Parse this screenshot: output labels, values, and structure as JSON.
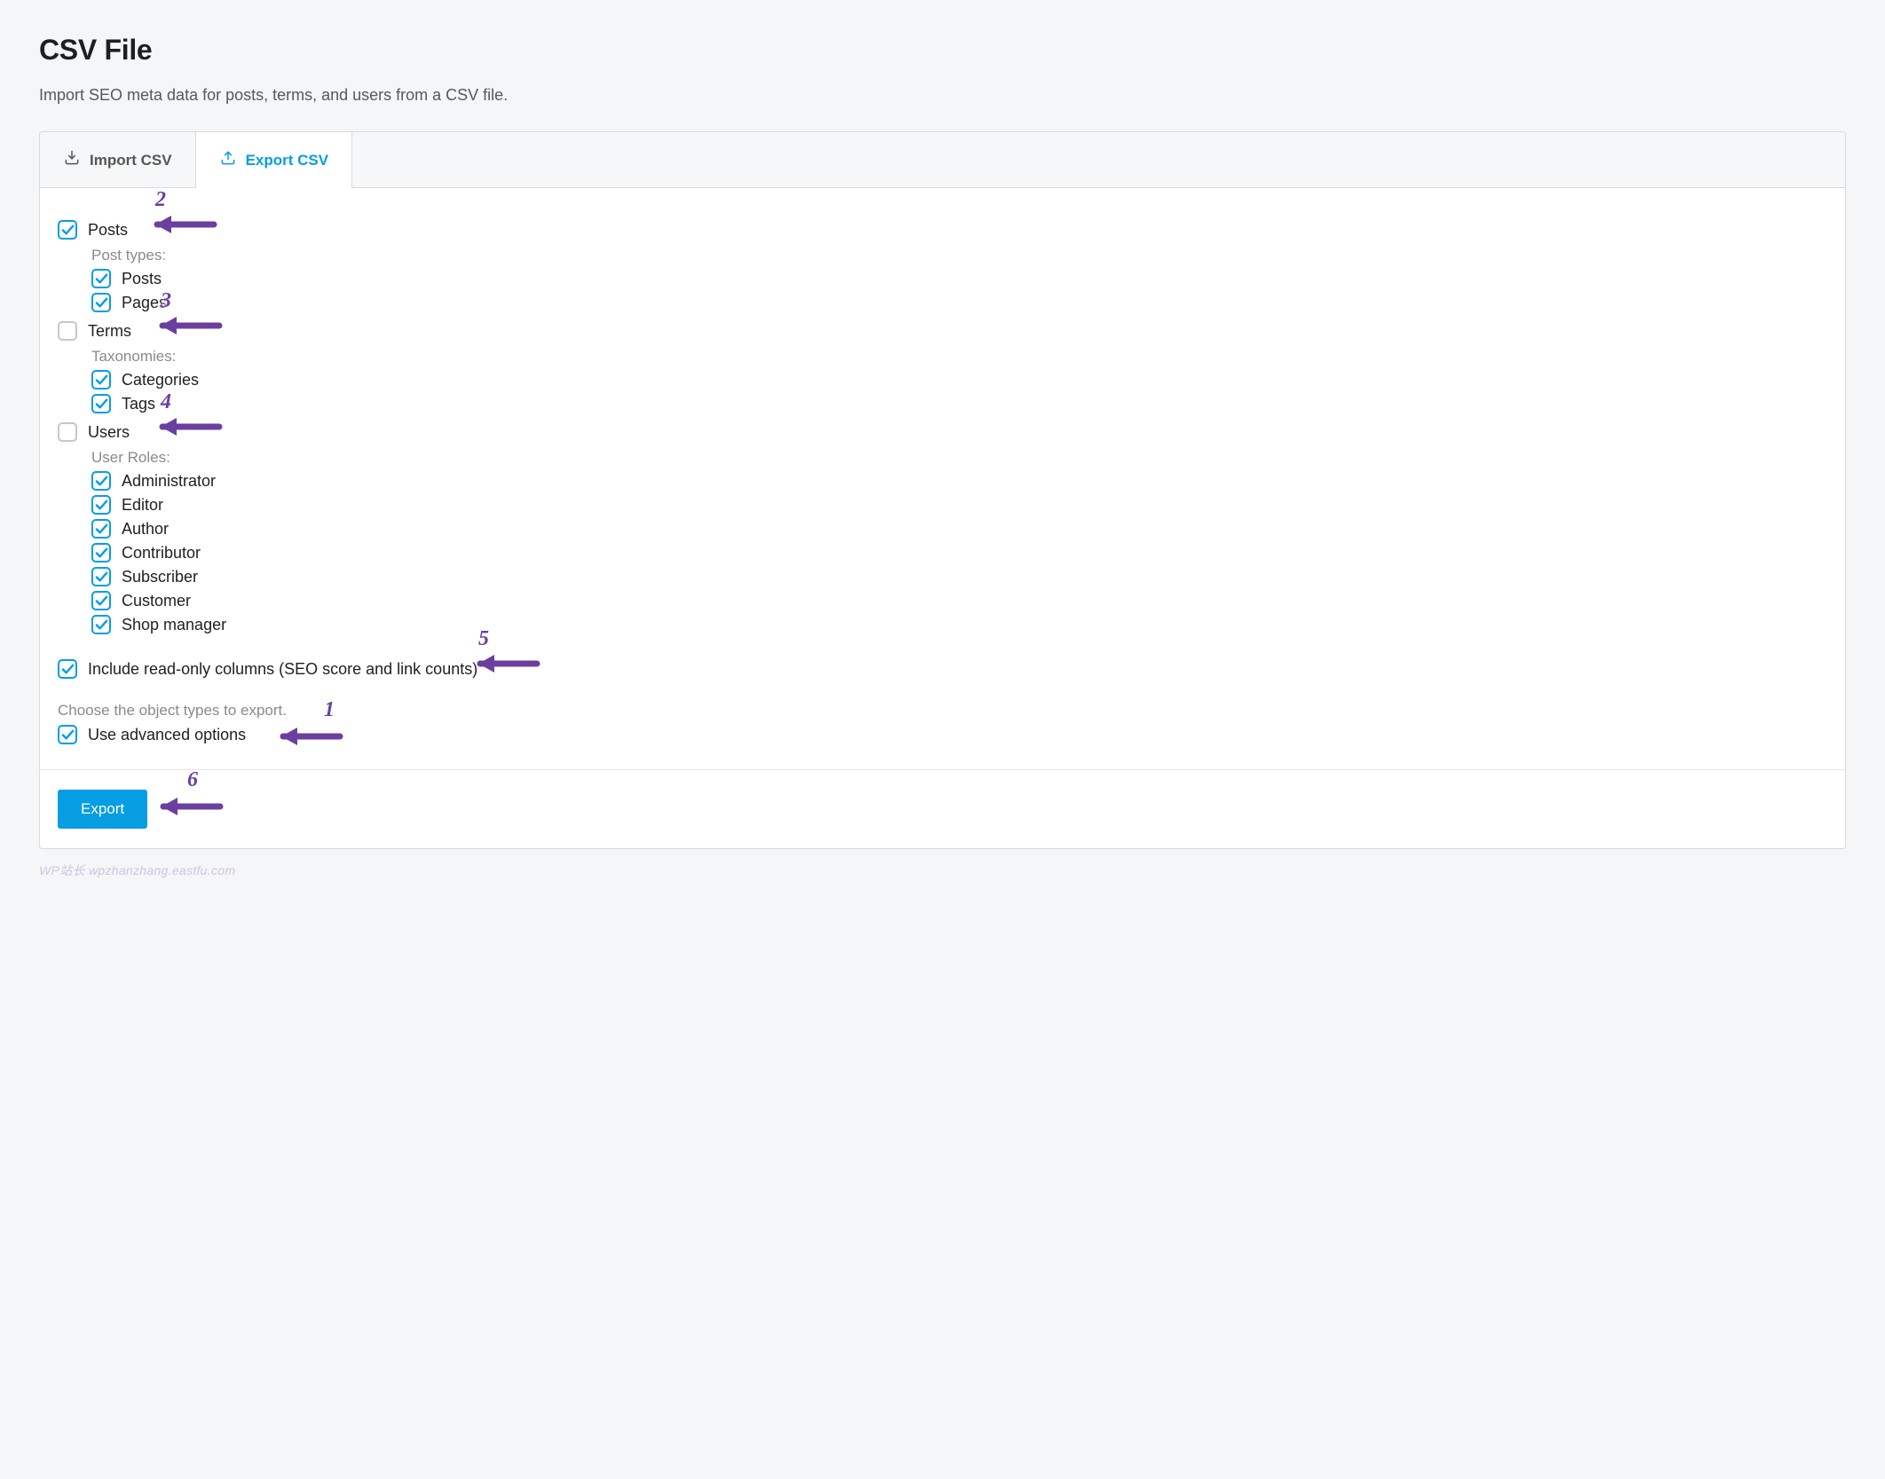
{
  "header": {
    "title": "CSV File",
    "subtitle": "Import SEO meta data for posts, terms, and users from a CSV file."
  },
  "tabs": {
    "import": "Import CSV",
    "export": "Export CSV"
  },
  "sections": {
    "posts": {
      "label": "Posts",
      "sub_label": "Post types:",
      "items": {
        "posts": "Posts",
        "pages": "Pages"
      }
    },
    "terms": {
      "label": "Terms",
      "sub_label": "Taxonomies:",
      "items": {
        "categories": "Categories",
        "tags": "Tags"
      }
    },
    "users": {
      "label": "Users",
      "sub_label": "User Roles:",
      "items": {
        "administrator": "Administrator",
        "editor": "Editor",
        "author": "Author",
        "contributor": "Contributor",
        "subscriber": "Subscriber",
        "customer": "Customer",
        "shop_manager": "Shop manager"
      }
    }
  },
  "options": {
    "readonly_columns": "Include read-only columns (SEO score and link counts)",
    "helper": "Choose the object types to export.",
    "advanced": "Use advanced options"
  },
  "footer": {
    "export_button": "Export"
  },
  "annotations": {
    "n1": "1",
    "n2": "2",
    "n3": "3",
    "n4": "4",
    "n5": "5",
    "n6": "6"
  },
  "watermark": "WP站长  wpzhanzhang.eastfu.com",
  "colors": {
    "accent": "#069de3",
    "annotation": "#6b3fa0"
  }
}
